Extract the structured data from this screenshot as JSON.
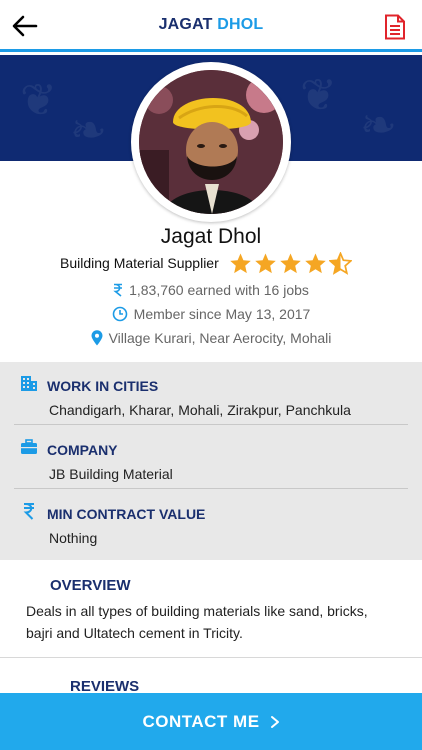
{
  "header": {
    "title_first": "JAGAT",
    "title_last": "DHOL",
    "back_icon": "arrow-left-icon",
    "doc_icon": "document-icon"
  },
  "profile": {
    "name": "Jagat Dhol",
    "role": "Building Material Supplier",
    "rating": 4.5,
    "rating_max": 5,
    "earned": "1,83,760 earned with 16 jobs",
    "member_since": "Member since May 13, 2017",
    "location": "Village Kurari, Near Aerocity, Mohali"
  },
  "details": {
    "cities": {
      "label": "WORK IN CITIES",
      "value": "Chandigarh, Kharar, Mohali, Zirakpur, Panchkula",
      "icon": "building-icon"
    },
    "company": {
      "label": "COMPANY",
      "value": "JB Building Material",
      "icon": "briefcase-icon"
    },
    "min_contract": {
      "label": "MIN CONTRACT VALUE",
      "value": "Nothing",
      "icon": "rupee-icon"
    }
  },
  "overview": {
    "label": "OVERVIEW",
    "text": "Deals in all types of building materials like sand, bricks, bajri and Ultatech cement in Tricity."
  },
  "reviews": {
    "label": "REVIEWS"
  },
  "cta": {
    "label": "CONTACT ME"
  },
  "colors": {
    "navy": "#1a2f6e",
    "accent": "#1c9be6",
    "banner": "#0f2a72",
    "star": "#f5a623",
    "cta": "#21a9ec"
  }
}
